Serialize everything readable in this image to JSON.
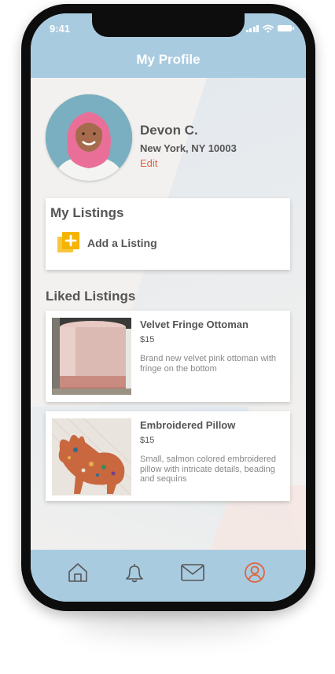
{
  "status_bar": {
    "time": "9:41"
  },
  "header": {
    "title": "My Profile"
  },
  "profile": {
    "name": "Devon C.",
    "location": "New York, NY 10003",
    "edit_label": "Edit"
  },
  "my_listings": {
    "heading": "My Listings",
    "add_label": "Add a Listing"
  },
  "liked_listings": {
    "heading": "Liked Listings",
    "items": [
      {
        "title": "Velvet Fringe Ottoman",
        "price": "$15",
        "description": "Brand new velvet pink ottoman with fringe on the bottom",
        "image": "pink-ottoman-photo"
      },
      {
        "title": "Embroidered Pillow",
        "price": "$15",
        "description": "Small, salmon colored embroidered pillow with intricate details, beading and sequins",
        "image": "deer-pillow-photo"
      }
    ]
  },
  "tab_bar": {
    "items": [
      {
        "icon": "home-icon",
        "active": false
      },
      {
        "icon": "bell-icon",
        "active": false
      },
      {
        "icon": "mail-icon",
        "active": false
      },
      {
        "icon": "profile-icon",
        "active": true
      }
    ]
  },
  "colors": {
    "header_bg": "#a9cbe0",
    "accent": "#e0643d",
    "icon_default": "#555555",
    "add_icon": "#f5b400"
  }
}
